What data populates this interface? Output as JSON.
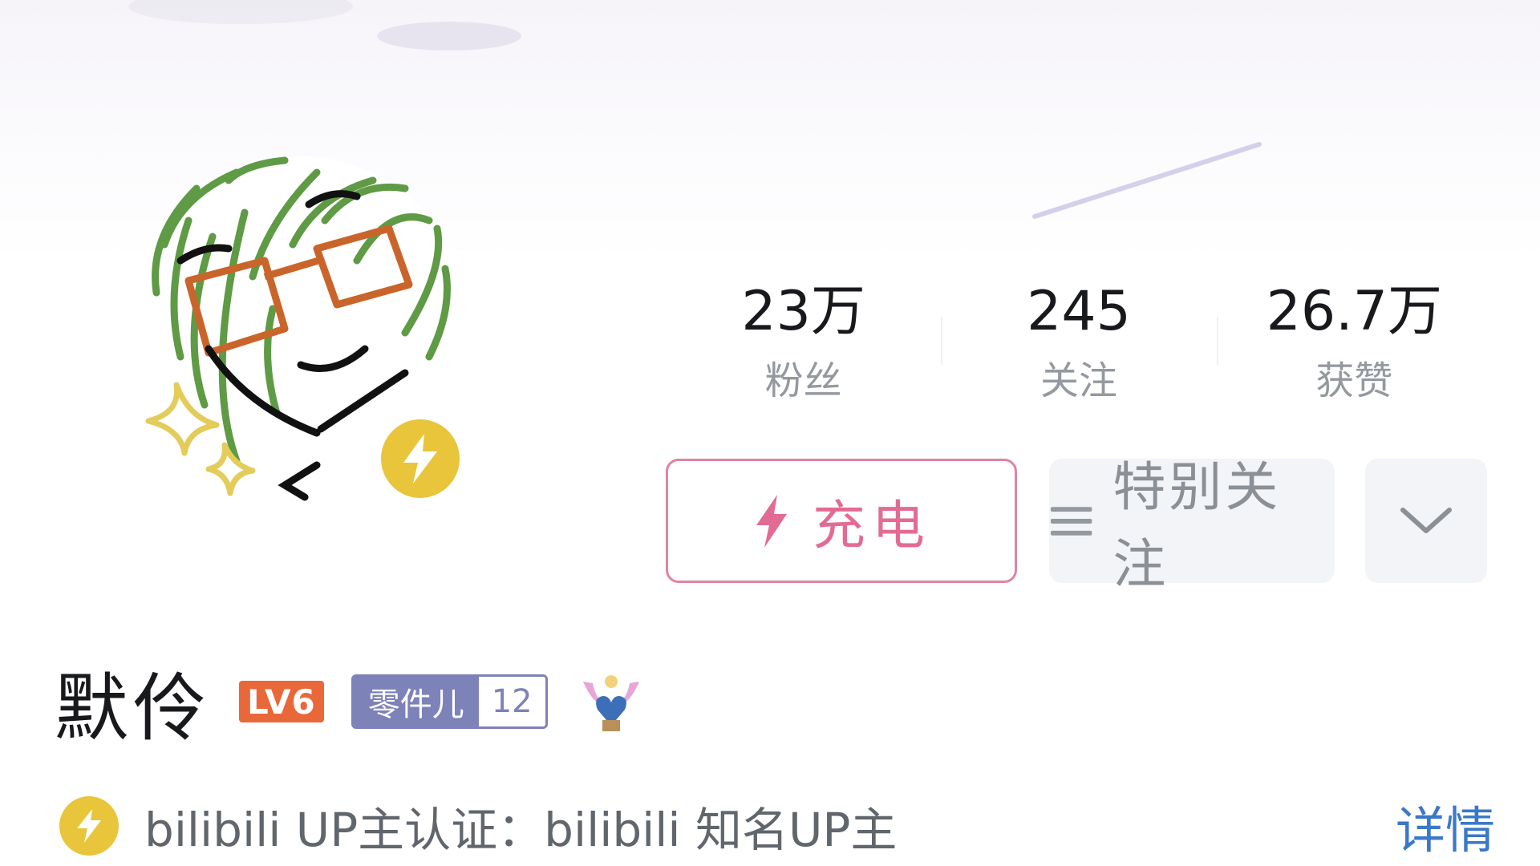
{
  "stats": [
    {
      "value": "23万",
      "label": "粉丝"
    },
    {
      "value": "245",
      "label": "关注"
    },
    {
      "value": "26.7万",
      "label": "获赞"
    }
  ],
  "buttons": {
    "charge_label": "充电",
    "follow_label": "特别关注"
  },
  "user": {
    "name": "默伶",
    "level": "LV6",
    "medal_name": "零件儿",
    "medal_level": "12"
  },
  "verification": {
    "text": "bilibili UP主认证：bilibili 知名UP主",
    "details_label": "详情"
  },
  "colors": {
    "charge_accent": "#e26b94",
    "verify_badge": "#e8c53a",
    "link": "#3a78c8",
    "level_badge": "#e8683a",
    "medal": "#7d82b8"
  },
  "icons": {
    "charge": "lightning-icon",
    "follow": "menu-lines-icon",
    "more": "chevron-down-icon",
    "verify": "lightning-badge-icon"
  }
}
